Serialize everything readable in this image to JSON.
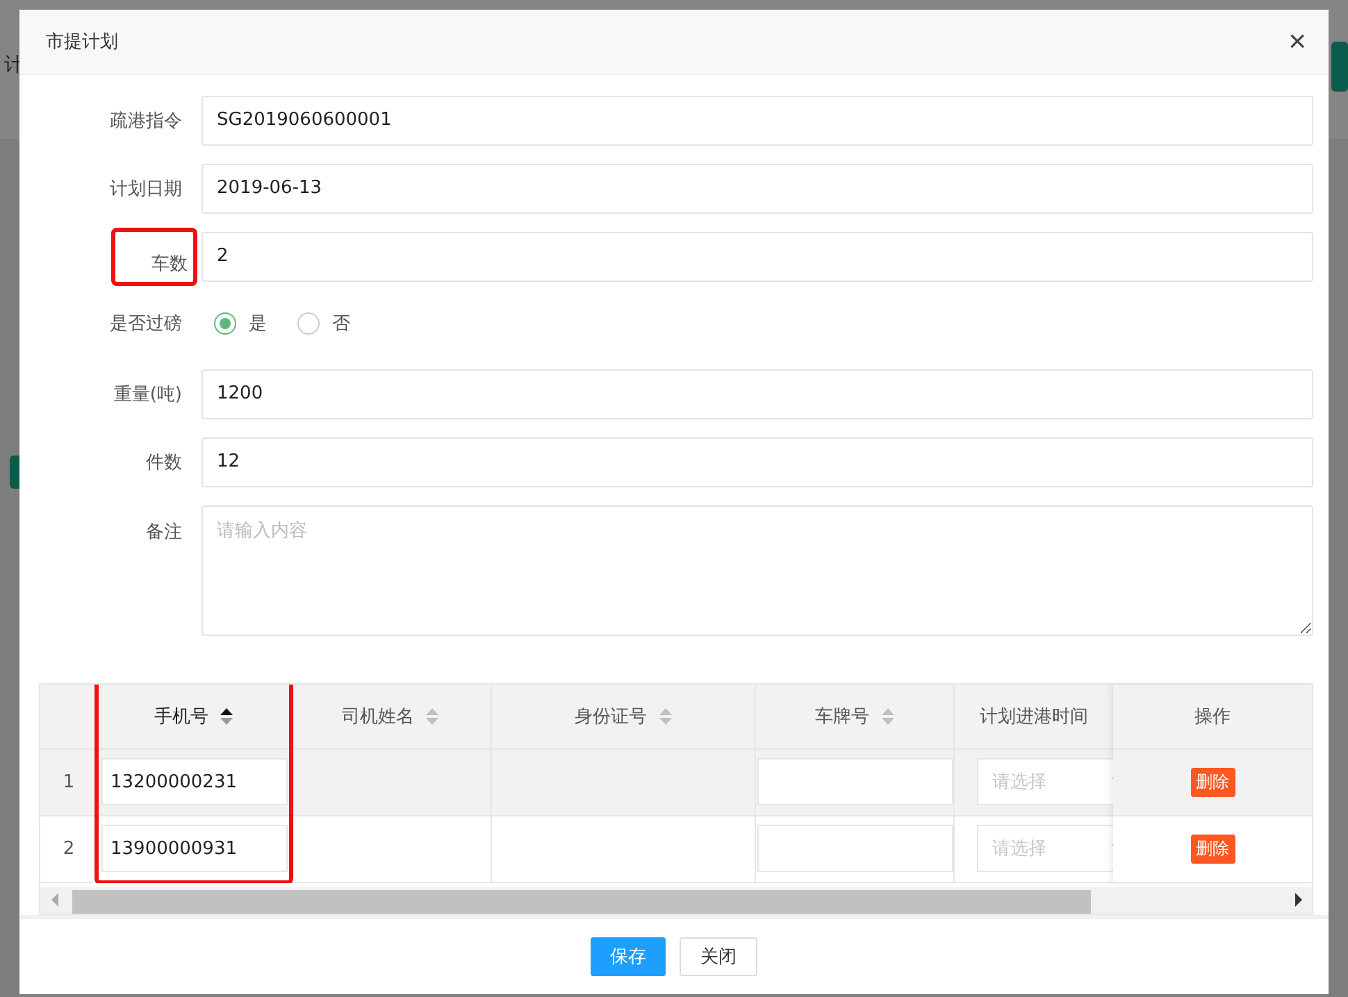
{
  "background": {
    "fragment": "计"
  },
  "dialog": {
    "title": "市提计划",
    "close": "×"
  },
  "form": [
    {
      "kind": "input",
      "label": "疏港指令",
      "value": "SG2019060600001",
      "highlighted": false
    },
    {
      "kind": "input",
      "label": "计划日期",
      "value": "2019-06-13",
      "highlighted": false
    },
    {
      "kind": "input",
      "label": "车数",
      "value": "2",
      "highlighted": true
    },
    {
      "kind": "radio",
      "label": "是否过磅",
      "options": [
        {
          "label": "是",
          "selected": true
        },
        {
          "label": "否",
          "selected": false
        }
      ],
      "highlighted": false
    },
    {
      "kind": "input",
      "label": "重量(吨)",
      "value": "1200",
      "highlighted": false
    },
    {
      "kind": "input",
      "label": "件数",
      "value": "12",
      "highlighted": false
    },
    {
      "kind": "textarea",
      "label": "备注",
      "placeholder": "请输入内容",
      "highlighted": false
    }
  ],
  "table": {
    "columns": [
      {
        "label": "手机号",
        "sortable": true,
        "sorted": true,
        "highlighted": true
      },
      {
        "label": "司机姓名",
        "sortable": true,
        "sorted": false,
        "highlighted": false
      },
      {
        "label": "身份证号",
        "sortable": true,
        "sorted": false,
        "highlighted": false
      },
      {
        "label": "车牌号",
        "sortable": true,
        "sorted": false,
        "highlighted": false
      },
      {
        "label": "计划进港时间",
        "sortable": false,
        "highlighted": false
      }
    ],
    "action_column": "操作",
    "rows": [
      {
        "index": "1",
        "phone": "13200000231",
        "time_placeholder": "请选择",
        "action": "删除"
      },
      {
        "index": "2",
        "phone": "13900000931",
        "time_placeholder": "请选择",
        "action": "删除"
      }
    ]
  },
  "buttons": [
    {
      "label": "保存",
      "kind": "primary"
    },
    {
      "label": "关闭",
      "kind": "default"
    }
  ]
}
